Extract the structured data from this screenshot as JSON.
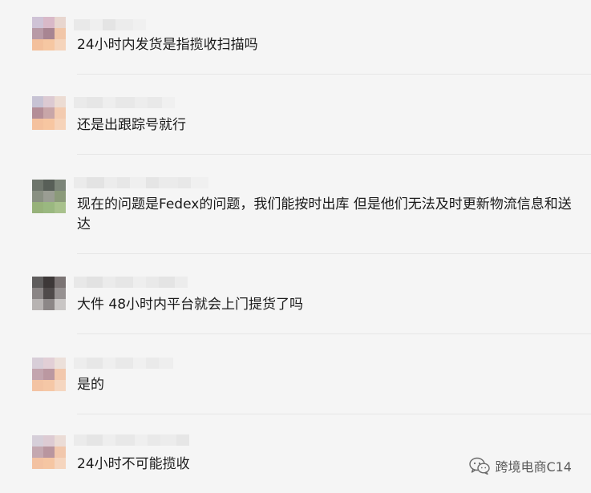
{
  "messages": [
    {
      "text": "24小时内发货是指揽收扫描吗"
    },
    {
      "text": "还是出跟踪号就行"
    },
    {
      "text": "现在的问题是Fedex的问题，我们能按时出库 但是他们无法及时更新物流信息和送达"
    },
    {
      "text": "大件 48小时内平台就会上门提货了吗"
    },
    {
      "text": "是的"
    },
    {
      "text": "24小时不可能揽收"
    }
  ],
  "watermark": {
    "label": "跨境电商C14",
    "icon": "wechat-icon"
  },
  "colors": {
    "background": "#f5f5f5",
    "text": "#1a1a1a",
    "divider": "#e6e6e6",
    "watermark": "#5a5a5a"
  }
}
